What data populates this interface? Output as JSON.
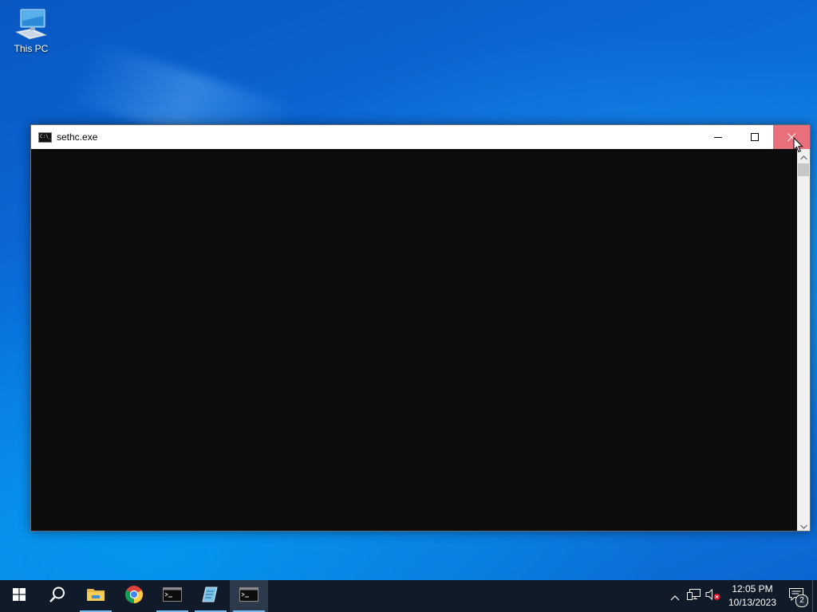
{
  "desktop": {
    "icons": [
      {
        "label": "This PC",
        "icon": "this-pc-icon"
      }
    ]
  },
  "window": {
    "title": "sethc.exe",
    "icon": "console-icon",
    "controls": {
      "minimize": "minimize-icon",
      "maximize": "maximize-icon",
      "close": "close-icon"
    },
    "colors": {
      "console_background": "#0c0c0c",
      "close_hover": "#e8707c"
    }
  },
  "taskbar": {
    "start": "windows-logo-icon",
    "search": "search-icon",
    "pinned": [
      {
        "name": "file-explorer",
        "icon": "folder-icon",
        "running": true
      },
      {
        "name": "chrome",
        "icon": "chrome-icon",
        "running": false
      },
      {
        "name": "command-prompt",
        "icon": "console-icon",
        "running": true
      },
      {
        "name": "notepad-app",
        "icon": "notepad-icon",
        "running": true
      },
      {
        "name": "sethc-console",
        "icon": "console-icon",
        "running": true,
        "active": true
      }
    ],
    "tray": {
      "chevron": "chevron-up-icon",
      "network": "network-icon",
      "volume": "volume-muted-icon",
      "time": "12:05 PM",
      "date": "10/13/2023",
      "notifications_count": "2"
    },
    "colors": {
      "background": "#101a28",
      "running_indicator": "#76b9ed"
    }
  }
}
